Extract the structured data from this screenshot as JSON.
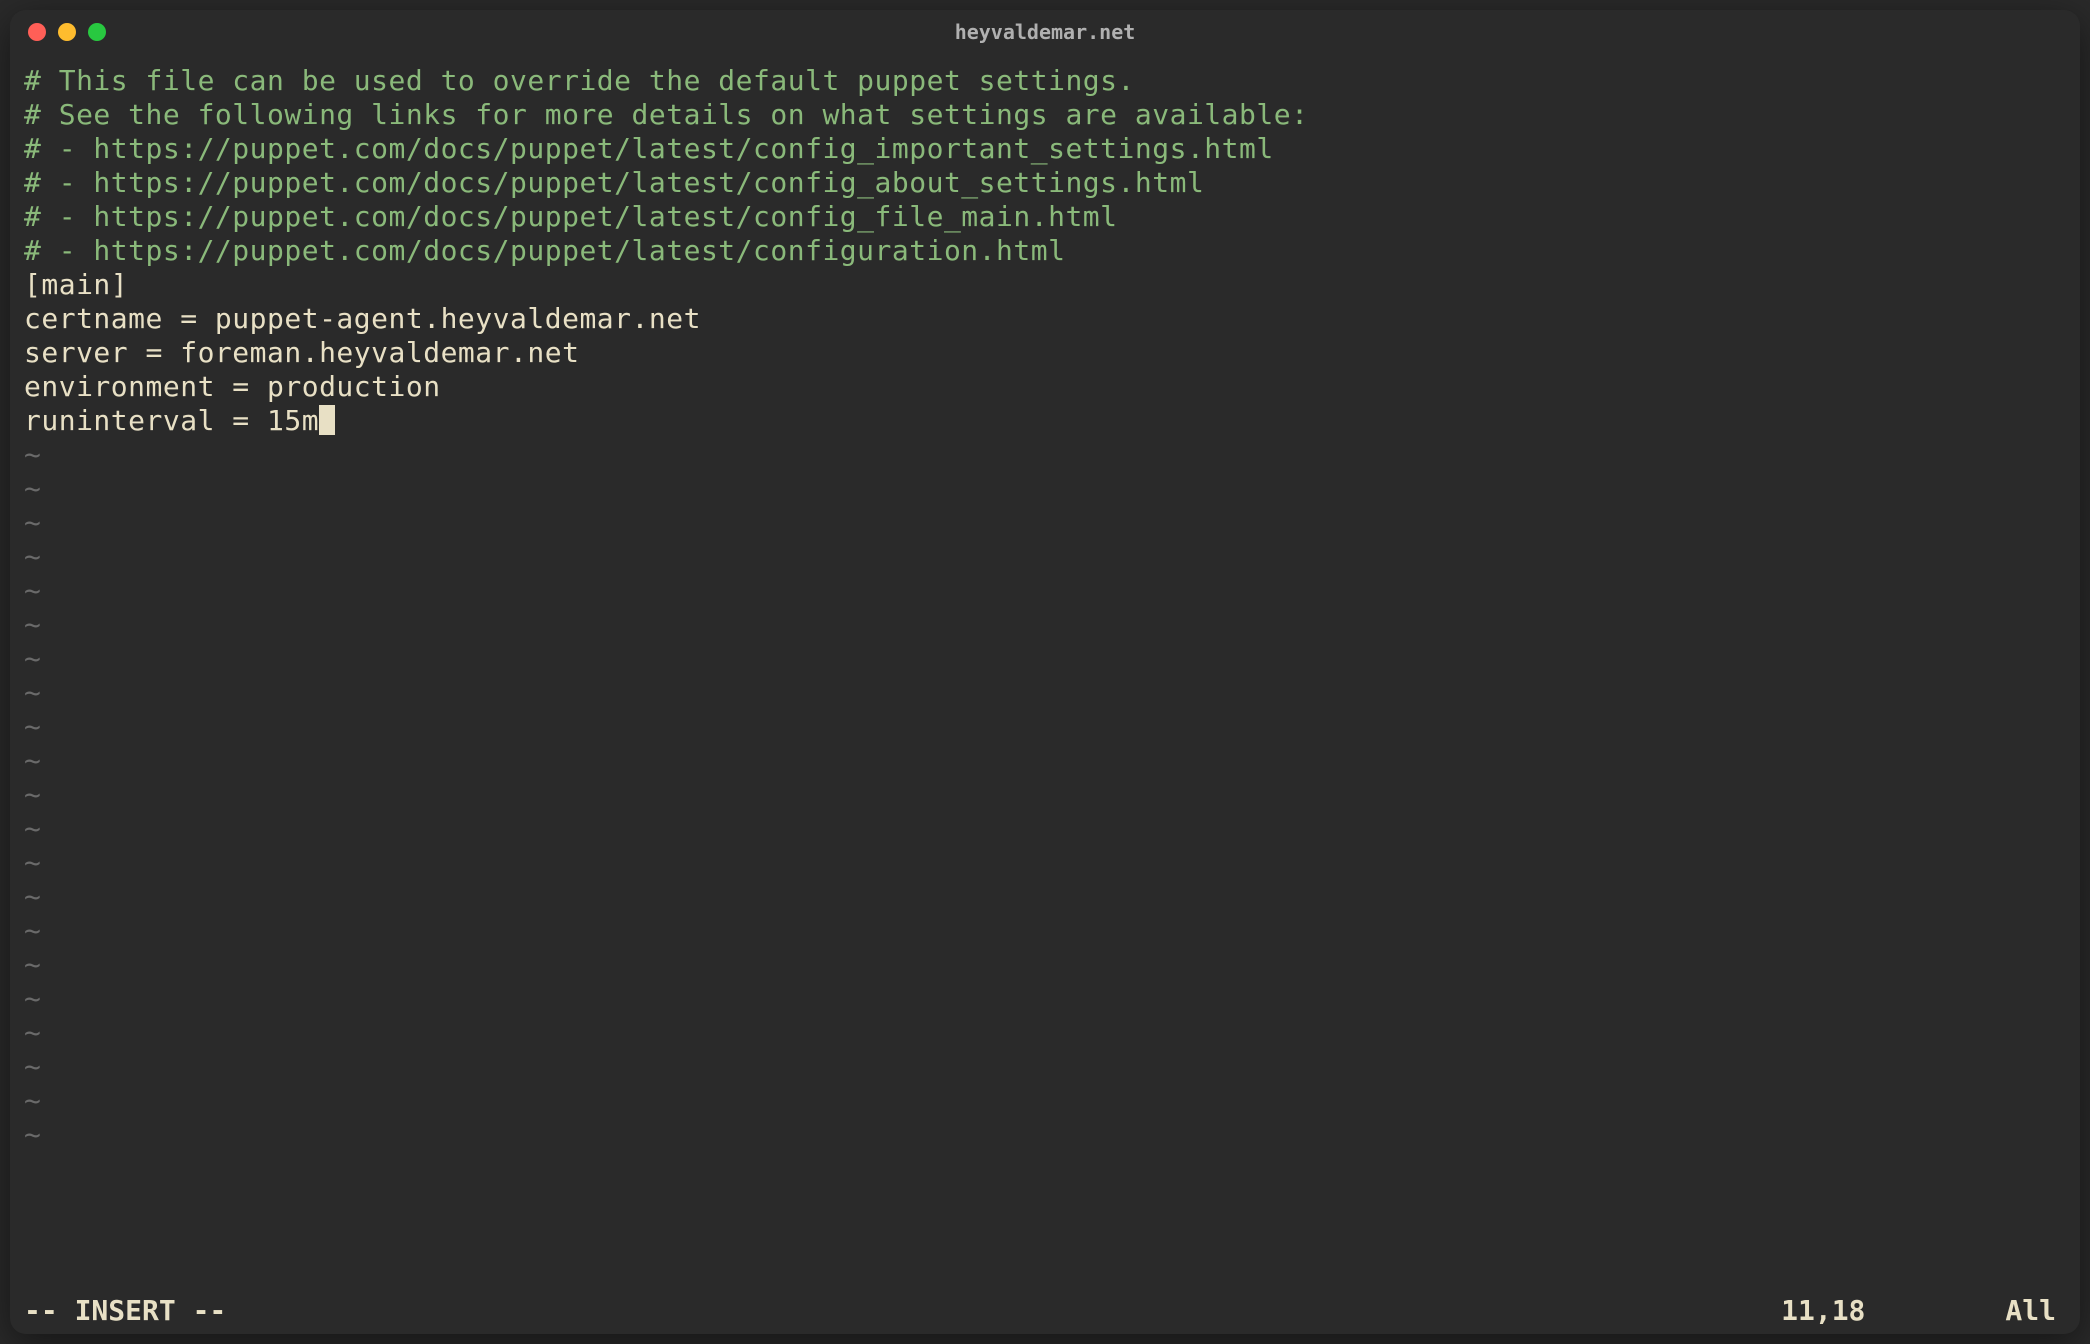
{
  "window": {
    "title": "heyvaldemar.net"
  },
  "file": {
    "comment_lines": [
      "# This file can be used to override the default puppet settings.",
      "# See the following links for more details on what settings are available:",
      "# - https://puppet.com/docs/puppet/latest/config_important_settings.html",
      "# - https://puppet.com/docs/puppet/latest/config_about_settings.html",
      "# - https://puppet.com/docs/puppet/latest/config_file_main.html",
      "# - https://puppet.com/docs/puppet/latest/configuration.html"
    ],
    "config_lines": [
      "[main]",
      "certname = puppet-agent.heyvaldemar.net",
      "server = foreman.heyvaldemar.net",
      "environment = production",
      "runinterval = 15m"
    ],
    "tilde_char": "~",
    "tilde_count": 21
  },
  "status": {
    "mode": "-- INSERT --",
    "position": "11,18",
    "view": "All"
  }
}
